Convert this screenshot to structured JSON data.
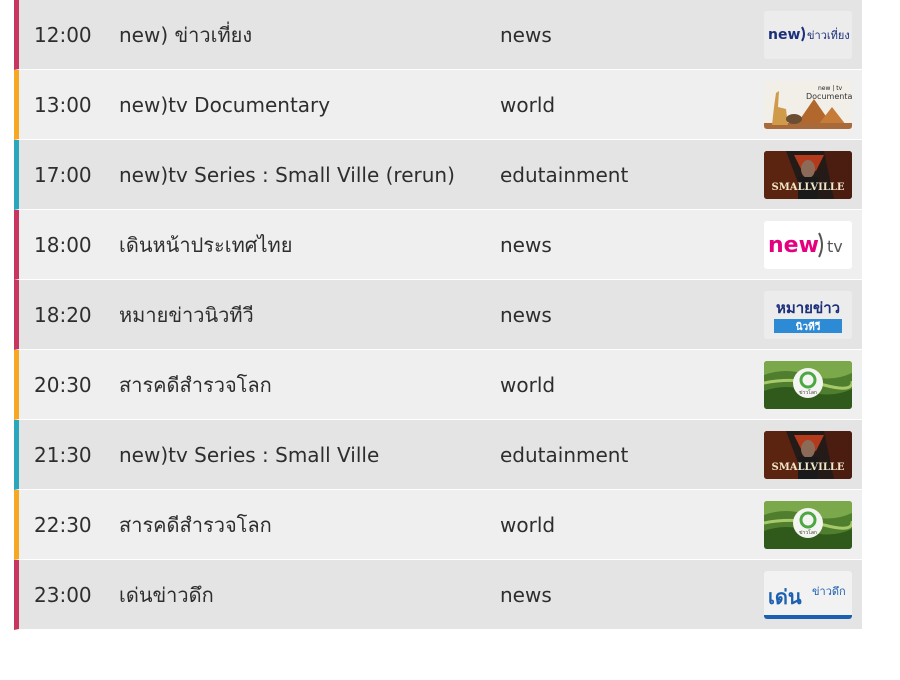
{
  "schedule": {
    "rows": [
      {
        "time": "12:00",
        "title": "new) ข่าวเที่ยง",
        "category": "news",
        "thumb_icon": "new-khao-thiang-logo-icon",
        "thumb_text": [
          "new",
          "ข่าวเที่ยง"
        ]
      },
      {
        "time": "13:00",
        "title": "new)tv Documentary",
        "category": "world",
        "thumb_icon": "documentary-thumbnail-icon",
        "thumb_text": [
          "new | tv",
          "Documentary"
        ]
      },
      {
        "time": "17:00",
        "title": "new)tv Series : Small Ville (rerun)",
        "category": "edutainment",
        "thumb_icon": "smallville-thumbnail-icon",
        "thumb_text": [
          "SMALLVILLE"
        ]
      },
      {
        "time": "18:00",
        "title": "เดินหน้าประเทศไทย",
        "category": "news",
        "thumb_icon": "newtv-logo-icon",
        "thumb_text": [
          "new",
          "tv"
        ]
      },
      {
        "time": "18:20",
        "title": "หมายข่าวนิวทีวี",
        "category": "news",
        "thumb_icon": "maikhao-newtv-logo-icon",
        "thumb_text": [
          "หมายข่าว",
          "นิวทีวี"
        ]
      },
      {
        "time": "20:30",
        "title": "สารคดีสำรวจโลก",
        "category": "world",
        "thumb_icon": "world-documentary-thumbnail-icon",
        "thumb_text": [
          "ข่าวโลก"
        ]
      },
      {
        "time": "21:30",
        "title": "new)tv Series : Small Ville",
        "category": "edutainment",
        "thumb_icon": "smallville-thumbnail-icon",
        "thumb_text": [
          "SMALLVILLE"
        ]
      },
      {
        "time": "22:30",
        "title": "สารคดีสำรวจโลก",
        "category": "world",
        "thumb_icon": "world-documentary-thumbnail-icon",
        "thumb_text": [
          "ข่าวโลก"
        ]
      },
      {
        "time": "23:00",
        "title": "เด่นข่าวดึก",
        "category": "news",
        "thumb_icon": "den-khao-duek-logo-icon",
        "thumb_text": [
          "เด่น",
          "ข่าวดึก"
        ]
      }
    ]
  },
  "colors": {
    "news": "#c8365f",
    "world": "#f7a823",
    "edutainment": "#2aa7bd"
  }
}
